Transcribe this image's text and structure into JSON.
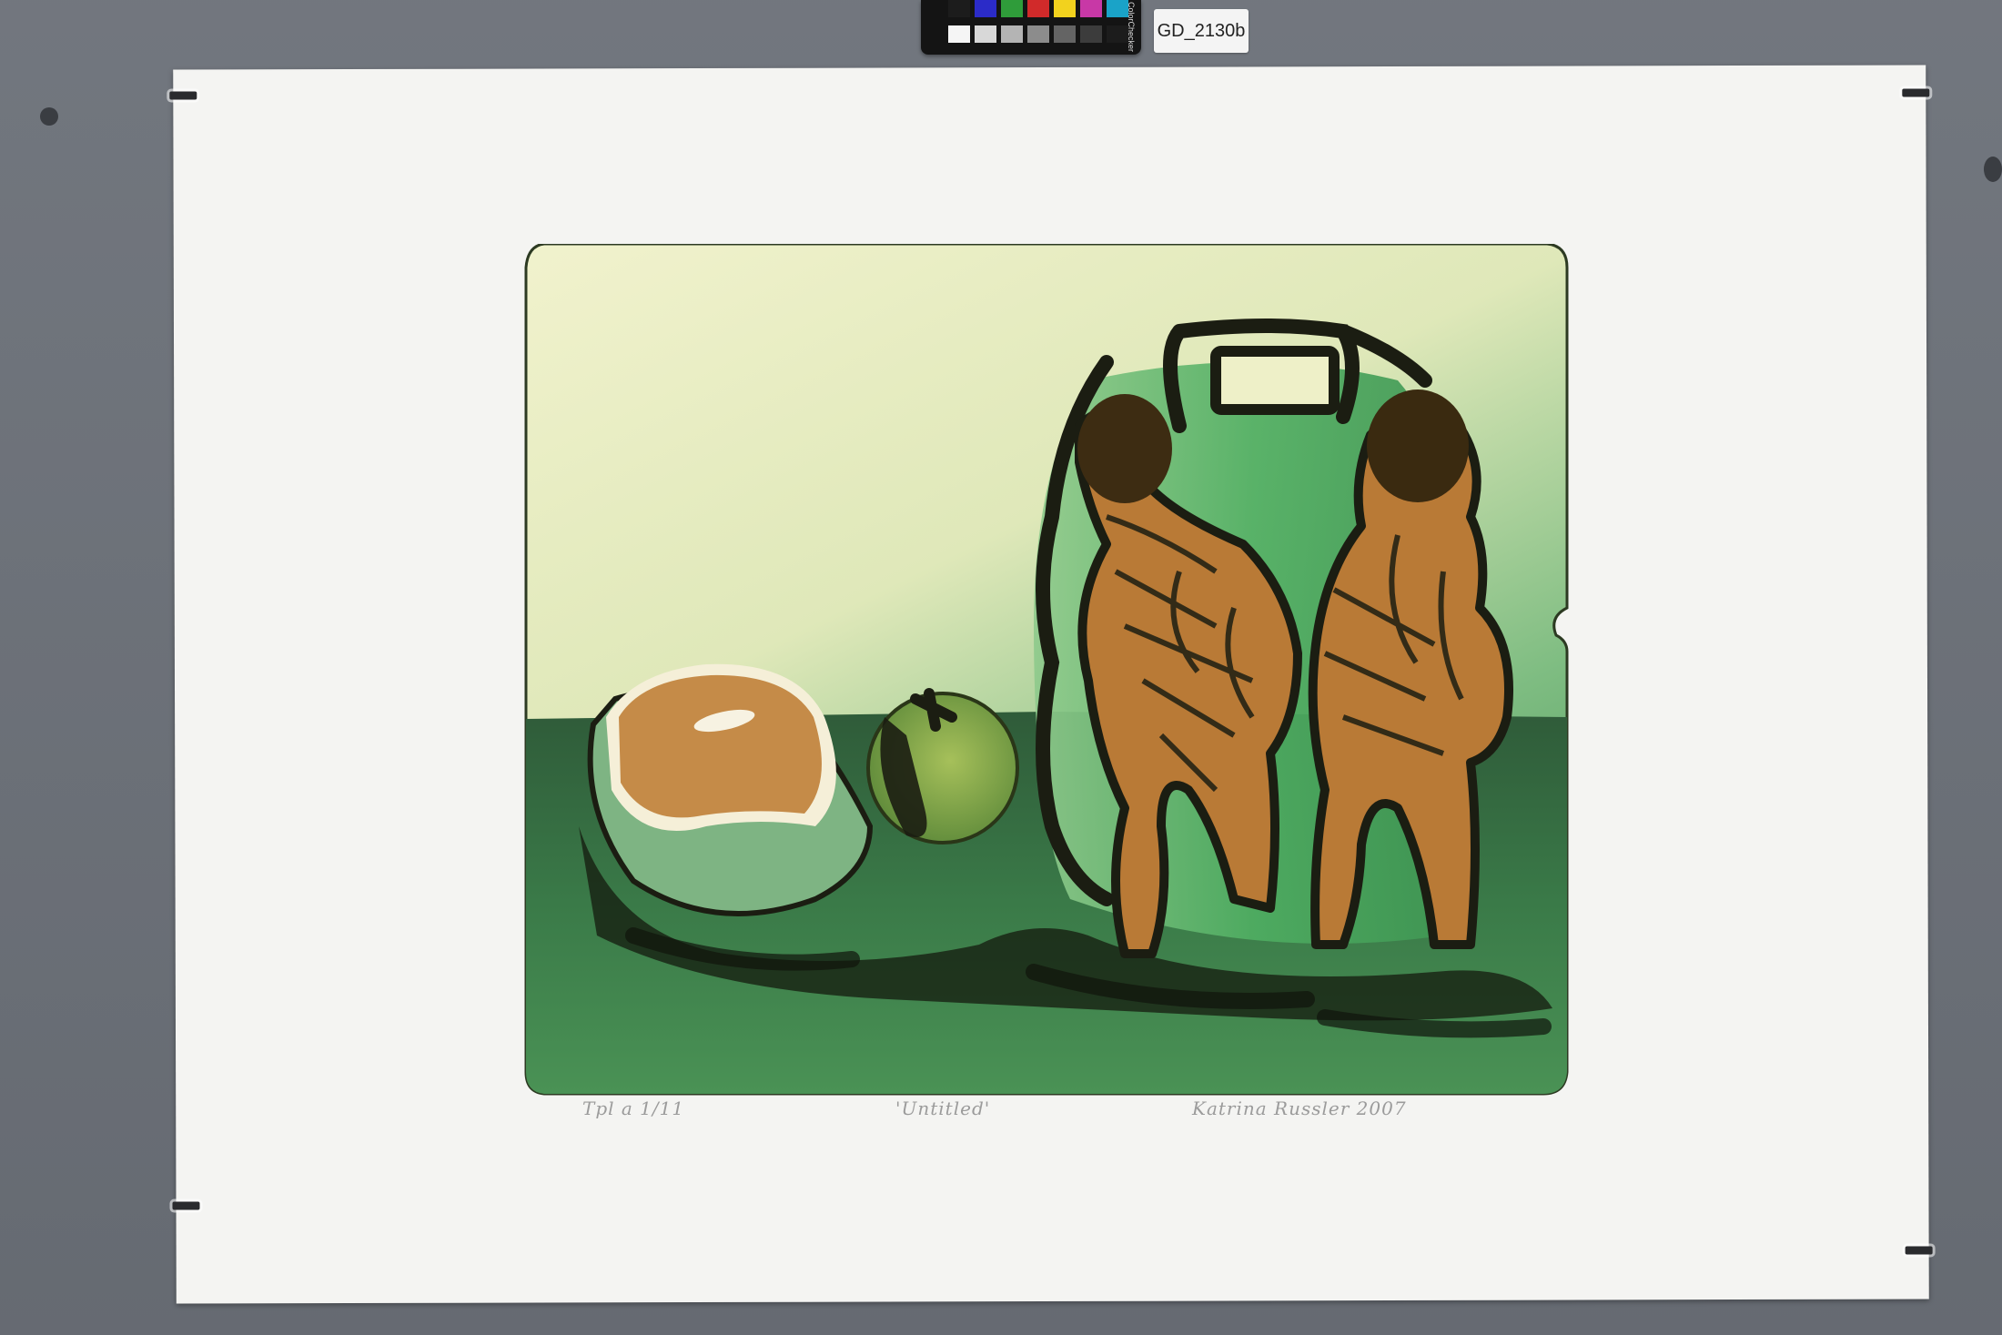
{
  "label": {
    "code": "GD_2130b"
  },
  "color_card": {
    "brand_text": "ColorChecker",
    "swatches_top": [
      "#1c1c1c",
      "#2b2bc8",
      "#2f9c3a",
      "#d12a2a",
      "#f2d21e",
      "#c838a6",
      "#1aa3c8"
    ],
    "swatches_bottom": [
      "#f5f5f5",
      "#d8d8d8",
      "#b4b4b4",
      "#8c8c8c",
      "#646464",
      "#3c3c3c",
      "#1c1c1c"
    ]
  },
  "artwork": {
    "edition": "Tpl a 1/11",
    "title": "'Untitled'",
    "signature": "Katrina Russler 2007"
  },
  "colors": {
    "background_light": "#eef0c8",
    "wall_green": "#5fa86a",
    "table_dark": "#2d5a36",
    "figure_ochre": "#b97a36",
    "ink": "#1b1d12"
  }
}
